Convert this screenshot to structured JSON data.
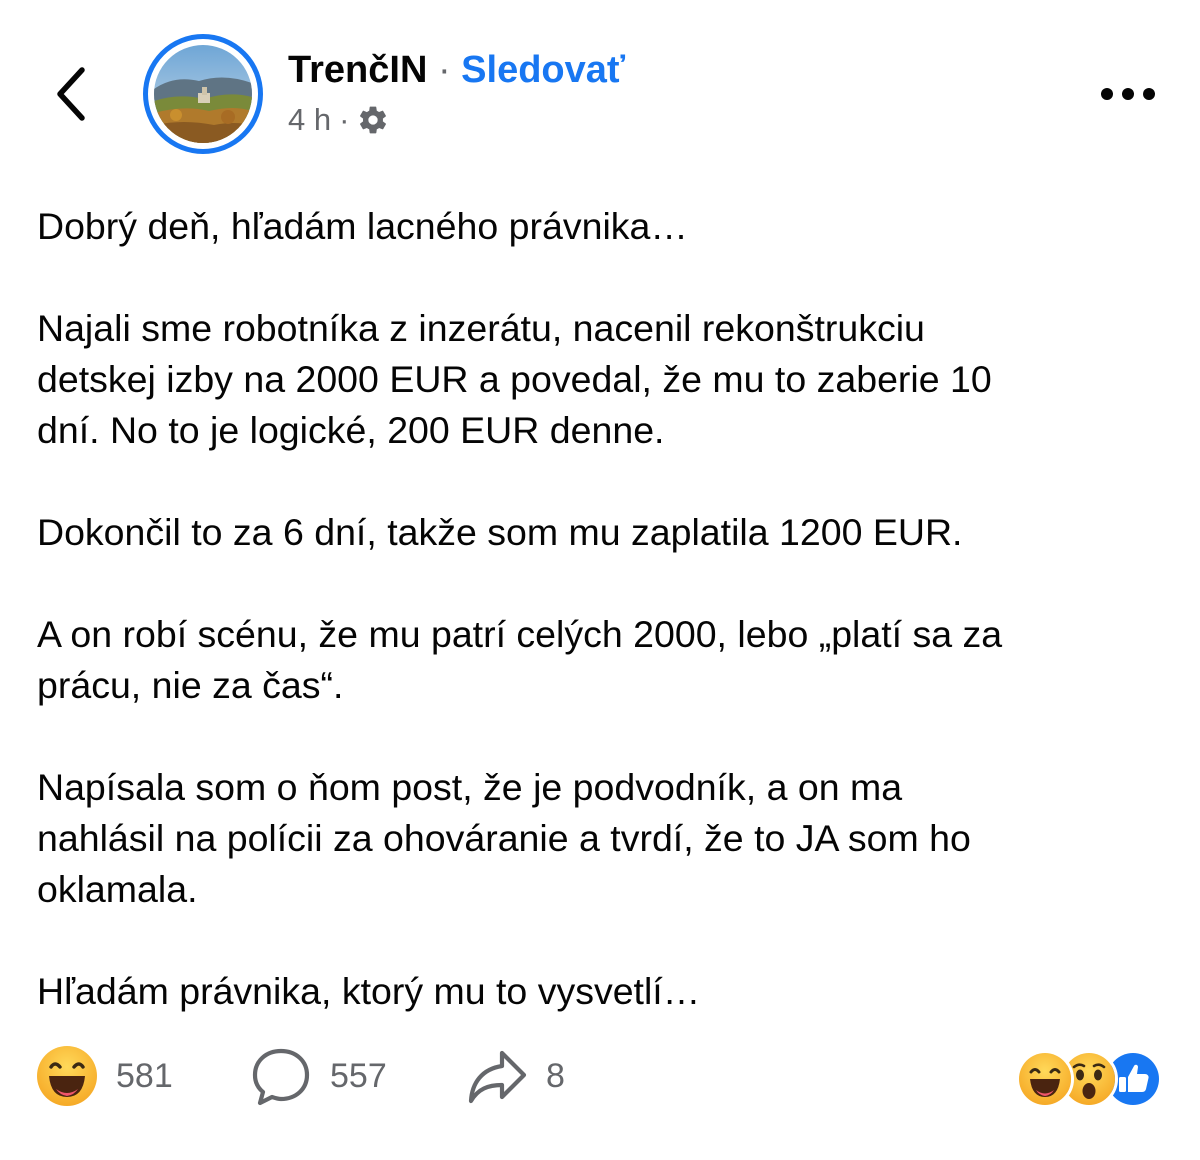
{
  "header": {
    "back_icon": "chevron-left-icon",
    "page_name": "TrenčIN",
    "separator": "·",
    "follow_label": "Sledovať",
    "time_ago": "4 h",
    "meta_separator": "·",
    "privacy_icon": "gear-icon",
    "more_icon": "more-horizontal-icon"
  },
  "post": {
    "paragraphs": [
      [
        "Dobrý deň, hľadám lacného právnika…"
      ],
      [
        "Najali sme robotníka z inzerátu, nacenil rekonštrukciu",
        "detskej izby na 2000 EUR a povedal, že mu to zaberie 10",
        "dní. No to je logické, 200 EUR denne."
      ],
      [
        "Dokončil to za 6 dní, takže som mu zaplatila 1200 EUR."
      ],
      [
        "A on robí scénu, že mu patrí celých 2000, lebo „platí sa za",
        "prácu, nie za čas“."
      ],
      [
        "Napísala som o ňom post, že je podvodník, a on ma",
        "nahlásil na polícii za ohováranie a tvrdí, že to JA som ho",
        "oklamala."
      ],
      [
        "Hľadám právnika, ktorý mu to vysvetlí…"
      ]
    ]
  },
  "footer": {
    "reaction_icon": "haha-emoji-icon",
    "reaction_count": "581",
    "comment_icon": "comment-bubble-icon",
    "comment_count": "557",
    "share_icon": "share-arrow-icon",
    "share_count": "8",
    "top_reactions": [
      "haha",
      "wow",
      "like"
    ]
  },
  "colors": {
    "accent": "#1877f2",
    "secondary_text": "#65676b",
    "primary_text": "#050505",
    "emoji_yellow": "#f7b125"
  }
}
